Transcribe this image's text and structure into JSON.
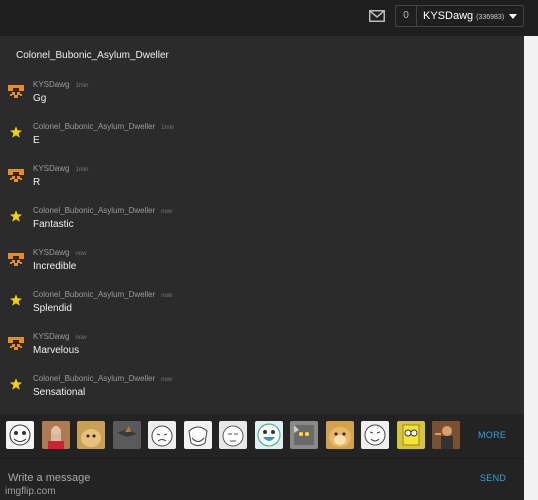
{
  "header": {
    "notification_count": "0",
    "username": "KYSDawg",
    "points": "(336983)"
  },
  "conversation": {
    "title": "Colonel_Bubonic_Asylum_Dweller",
    "messages": [
      {
        "user": "KYSDawg",
        "time": "1min",
        "text": "Gg",
        "avatar": "orange-face"
      },
      {
        "user": "Colonel_Bubonic_Asylum_Dweller",
        "time": "1min",
        "text": "E",
        "avatar": "star"
      },
      {
        "user": "KYSDawg",
        "time": "1min",
        "text": "R",
        "avatar": "orange-face"
      },
      {
        "user": "Colonel_Bubonic_Asylum_Dweller",
        "time": "now",
        "text": "Fantastic",
        "avatar": "star"
      },
      {
        "user": "KYSDawg",
        "time": "now",
        "text": "Incredible",
        "avatar": "orange-face"
      },
      {
        "user": "Colonel_Bubonic_Asylum_Dweller",
        "time": "now",
        "text": "Splendid",
        "avatar": "star"
      },
      {
        "user": "KYSDawg",
        "time": "now",
        "text": "Marvelous",
        "avatar": "orange-face"
      },
      {
        "user": "Colonel_Bubonic_Asylum_Dweller",
        "time": "now",
        "text": "Sensational",
        "avatar": "star"
      }
    ]
  },
  "emoji_bar": {
    "items": [
      "rage-face-icon",
      "bishop-image",
      "doge-image",
      "flying-bird-image",
      "forever-alone-icon",
      "troll-face-icon",
      "tired-face-icon",
      "laughing-face-icon",
      "cat-image",
      "doge-face-image",
      "meme-face-icon",
      "spongebob-image",
      "man-pointing-image"
    ],
    "more_label": "MORE"
  },
  "compose": {
    "placeholder": "Write a message",
    "send_label": "SEND"
  },
  "watermark": "imgflip.com",
  "colors": {
    "accent": "#3aa1e0",
    "background": "#2b2b2b",
    "orange_avatar": "#f08a1c",
    "star_avatar": "#f5d000"
  }
}
